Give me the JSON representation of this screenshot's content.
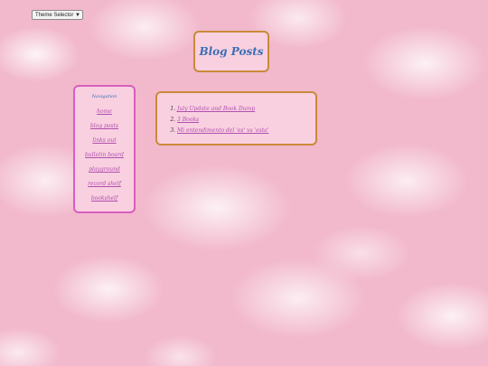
{
  "theme_selector": {
    "selected": "Theme Selector"
  },
  "header": {
    "title": "Blog Posts"
  },
  "navigation": {
    "heading": "Navigation",
    "items": [
      {
        "label": "home"
      },
      {
        "label": "blog posts"
      },
      {
        "label": "links out"
      },
      {
        "label": "bulletin board"
      },
      {
        "label": "playground"
      },
      {
        "label": "record shelf"
      },
      {
        "label": "bookshelf"
      }
    ]
  },
  "posts": [
    {
      "label": "July Update and Book Dump"
    },
    {
      "label": "3 Books"
    },
    {
      "label": "Mi entendimento del 'es' vs 'esta'"
    }
  ],
  "colors": {
    "title_text": "#3a6fb5",
    "link_text": "#b04fae",
    "title_border": "#c98a3a",
    "nav_border": "#d85ec0",
    "panel_bg": "#f9d0e0"
  }
}
